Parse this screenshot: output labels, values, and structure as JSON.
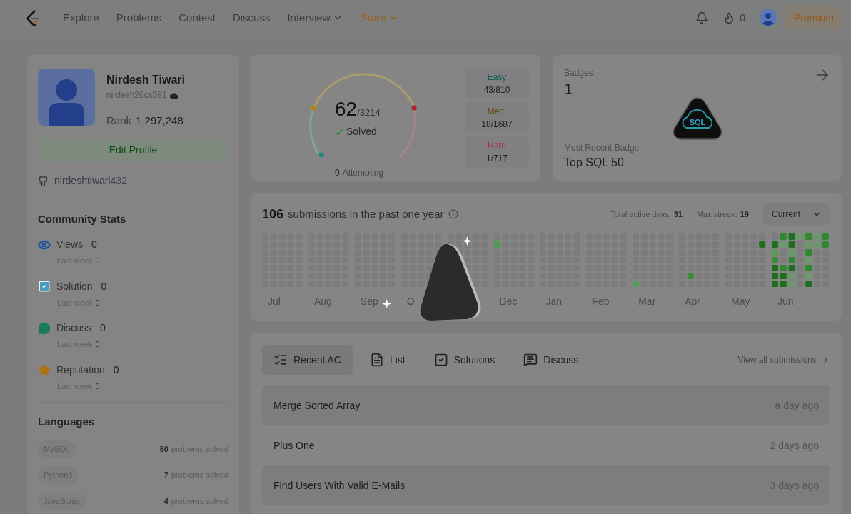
{
  "nav": {
    "items": [
      {
        "label": "Explore",
        "kind": "link"
      },
      {
        "label": "Problems",
        "kind": "link"
      },
      {
        "label": "Contest",
        "kind": "link"
      },
      {
        "label": "Discuss",
        "kind": "link"
      },
      {
        "label": "Interview",
        "kind": "menu"
      },
      {
        "label": "Store",
        "kind": "store"
      }
    ],
    "streak": "0",
    "premium": "Premium"
  },
  "profile": {
    "name": "Nirdesh Tiwari",
    "username": "nirdesh26cs081",
    "rank_label": "Rank",
    "rank": "1,297,248",
    "edit": "Edit Profile",
    "github": "nirdeshtiwari432"
  },
  "community": {
    "title": "Community Stats",
    "stats": [
      {
        "kind": "views",
        "label": "Views",
        "value": "0",
        "sub_label": "Last week",
        "sub_value": "0"
      },
      {
        "kind": "solution",
        "label": "Solution",
        "value": "0",
        "sub_label": "Last week",
        "sub_value": "0"
      },
      {
        "kind": "discuss",
        "label": "Discuss",
        "value": "0",
        "sub_label": "Last week",
        "sub_value": "0"
      },
      {
        "kind": "reputation",
        "label": "Reputation",
        "value": "0",
        "sub_label": "Last week",
        "sub_value": "0"
      }
    ]
  },
  "languages": {
    "title": "Languages",
    "items": [
      {
        "name": "MySQL",
        "count": "50",
        "suffix": "problems solved"
      },
      {
        "name": "Python3",
        "count": "7",
        "suffix": "problems solved"
      },
      {
        "name": "JavaScript",
        "count": "4",
        "suffix": "problems solved"
      }
    ]
  },
  "solved": {
    "solved": "62",
    "total": "/3214",
    "label": "Solved",
    "attempting_count": "0",
    "attempting": "Attempting",
    "difficulties": [
      {
        "label": "Easy",
        "value": "43/810",
        "color": "#0c5f56"
      },
      {
        "label": "Med.",
        "value": "18/1687",
        "color": "#634a06"
      },
      {
        "label": "Hard",
        "value": "1/717",
        "color": "#a33a44"
      }
    ]
  },
  "badges": {
    "title": "Badges",
    "count": "1",
    "badge_text": "SQL",
    "recent_label": "Most Recent Badge",
    "recent": "Top SQL 50"
  },
  "activity": {
    "count": "106",
    "text": "submissions in the past one year",
    "active_label": "Total active days:",
    "active": "31",
    "streak_label": "Max streak:",
    "streak": "19",
    "period": "Current",
    "months": [
      {
        "kind": "label",
        "label": "Jul"
      },
      {
        "kind": "label",
        "label": "Aug"
      },
      {
        "kind": "label",
        "label": "Sep"
      },
      {
        "kind": "label",
        "label": "O"
      },
      {
        "kind": "blank"
      },
      {
        "kind": "label",
        "label": "Dec"
      },
      {
        "kind": "label",
        "label": "Jan"
      },
      {
        "kind": "label",
        "label": "Feb"
      },
      {
        "kind": "label",
        "label": "Mar"
      },
      {
        "kind": "label",
        "label": "Apr"
      },
      {
        "kind": "label",
        "label": "May"
      },
      {
        "kind": "label",
        "label": "Jun"
      }
    ]
  },
  "recent": {
    "tabs": [
      {
        "label": "Recent AC",
        "kind": "recent",
        "selected": true
      },
      {
        "label": "List",
        "kind": "list",
        "selected": false
      },
      {
        "label": "Solutions",
        "kind": "solutions",
        "selected": false
      },
      {
        "label": "Discuss",
        "kind": "discuss",
        "selected": false
      }
    ],
    "view_all": "View all submissions",
    "rows": [
      {
        "title": "Merge Sorted Array",
        "time": "a day ago"
      },
      {
        "title": "Plus One",
        "time": "2 days ago"
      },
      {
        "title": "Find Users With Valid E-Mails",
        "time": "3 days ago"
      }
    ]
  }
}
